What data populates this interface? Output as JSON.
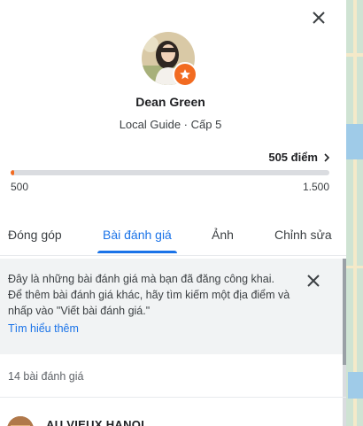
{
  "profile": {
    "name": "Dean Green",
    "subtitle": "Local Guide · Cấp 5"
  },
  "progress": {
    "points_label": "505 điểm",
    "min_label": "500",
    "max_label": "1.500",
    "fraction": 0.005
  },
  "tabs": [
    {
      "label": "Đóng góp",
      "active": false
    },
    {
      "label": "Bài đánh giá",
      "active": true
    },
    {
      "label": "Ảnh",
      "active": false
    },
    {
      "label": "Chỉnh sửa",
      "active": false
    }
  ],
  "info_banner": {
    "text": "Đây là những bài đánh giá mà bạn đã đăng công khai. Để thêm bài đánh giá khác, hãy tìm kiếm một địa điểm và nhấp vào \"Viết bài đánh giá.\"",
    "link": "Tìm hiểu thêm"
  },
  "reviews": {
    "count_label": "14 bài đánh giá",
    "first_place": "AU VIEUX HANOI"
  },
  "colors": {
    "accent": "#1a73e8",
    "progress_fill": "#f26b21",
    "badge": "#f26b21"
  },
  "icons": {
    "close": "close-icon",
    "guide_badge": "star-icon",
    "points_chevron": "chevron-right-icon",
    "banner_close": "close-icon"
  }
}
